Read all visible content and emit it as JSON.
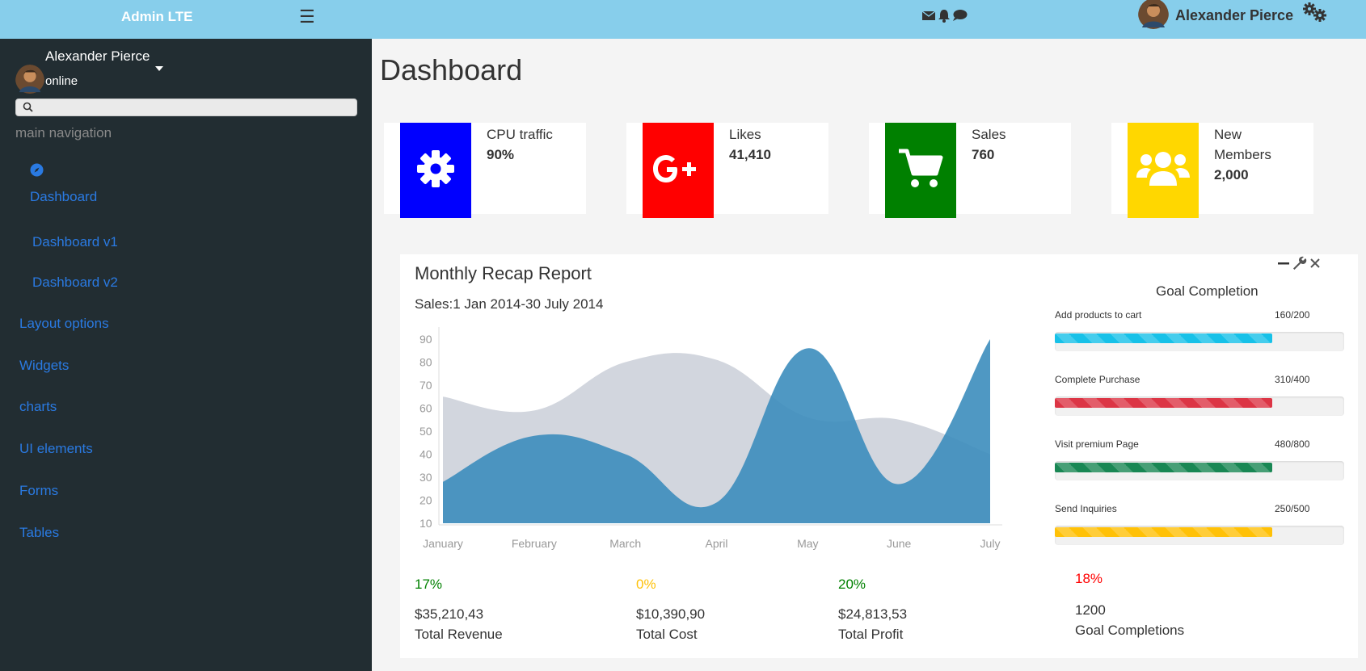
{
  "app": {
    "brand": "Admin LTE"
  },
  "topbar": {
    "menu_icon": "hamburger-icon",
    "icons": [
      "envelope-icon",
      "bell-icon",
      "comment-icon"
    ],
    "user_name": "Alexander Pierce",
    "settings_icon": "gears-icon"
  },
  "sidebar": {
    "user_name": "Alexander Pierce",
    "status": "online",
    "search_placeholder": "",
    "header": "main navigation",
    "items": [
      {
        "label": "Dashboard",
        "icon": "compass-icon"
      },
      {
        "label": "Dashboard v1"
      },
      {
        "label": "Dashboard v2"
      },
      {
        "label": "Layout options"
      },
      {
        "label": "Widgets"
      },
      {
        "label": "charts"
      },
      {
        "label": "UI elements"
      },
      {
        "label": "Forms"
      },
      {
        "label": "Tables"
      }
    ]
  },
  "page": {
    "title": "Dashboard"
  },
  "info_boxes": [
    {
      "label": "CPU traffic",
      "value": "90%",
      "color": "#0000ff",
      "icon": "gear-icon"
    },
    {
      "label": "Likes",
      "value": "41,410",
      "color": "#ff0000",
      "icon": "google-plus-icon"
    },
    {
      "label": "Sales",
      "value": "760",
      "color": "#008000",
      "icon": "shopping-cart-icon"
    },
    {
      "label_line1": "New",
      "label_line2": "Members",
      "value": "2,000",
      "color": "#ffd700",
      "icon": "users-icon"
    }
  ],
  "report": {
    "title": "Monthly Recap Report",
    "subtitle": "Sales:1 Jan 2014-30 July 2014",
    "tools": [
      "minus-icon",
      "wrench-icon",
      "close-icon"
    ],
    "stats": [
      {
        "pct": "17%",
        "amount": "$35,210,43",
        "label": "Total Revenue",
        "color": "#008000"
      },
      {
        "pct": "0%",
        "amount": "$10,390,90",
        "label": "Total Cost",
        "color": "#ffc107"
      },
      {
        "pct": "20%",
        "amount": "$24,813,53",
        "label": "Total Profit",
        "color": "#008000"
      }
    ],
    "goal_title": "Goal Completion",
    "goals": [
      {
        "label": "Add products to cart",
        "value": "160/200",
        "fraction": 0.75,
        "color": "#17c1e8"
      },
      {
        "label": "Complete Purchase",
        "value": "310/400",
        "fraction": 0.75,
        "color": "#dc3545"
      },
      {
        "label": "Visit premium Page",
        "value": "480/800",
        "fraction": 0.75,
        "color": "#198754"
      },
      {
        "label": "Send Inquiries",
        "value": "250/500",
        "fraction": 0.75,
        "color": "#ffc107"
      }
    ],
    "goal_pct": "18%",
    "goal_pct_color": "#ff0000",
    "goal_count": "1200",
    "goal_count_label": "Goal Completions"
  },
  "chart_data": {
    "type": "area",
    "categories": [
      "January",
      "February",
      "March",
      "April",
      "May",
      "June",
      "July"
    ],
    "ylim": [
      10,
      90
    ],
    "yticks": [
      10,
      20,
      30,
      40,
      50,
      60,
      70,
      80,
      90
    ],
    "series": [
      {
        "values": [
          65,
          59,
          80,
          81,
          56,
          55,
          40
        ],
        "color": "#d2d6de"
      },
      {
        "values": [
          28,
          48,
          40,
          19,
          86,
          27,
          90
        ],
        "color": "#3c8dbc"
      }
    ]
  }
}
